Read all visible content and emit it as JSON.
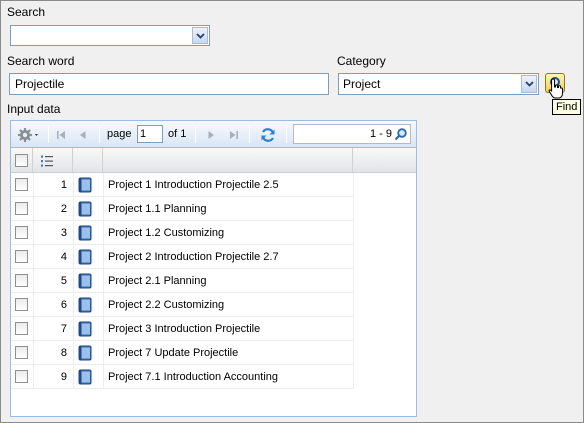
{
  "search": {
    "label": "Search",
    "value": ""
  },
  "search_word": {
    "label": "Search word",
    "value": "Projectile"
  },
  "category": {
    "label": "Category",
    "value": "Project"
  },
  "find": {
    "tooltip": "Find"
  },
  "input_data": {
    "label": "Input data"
  },
  "pager": {
    "page_label": "page",
    "page_value": "1",
    "of_label": "of 1",
    "range": "1 - 9"
  },
  "rows": [
    {
      "num": "1",
      "title": "Project 1 Introduction Projectile 2.5"
    },
    {
      "num": "2",
      "title": "Project 1.1 Planning"
    },
    {
      "num": "3",
      "title": "Project 1.2 Customizing"
    },
    {
      "num": "4",
      "title": "Project 2 Introduction Projectile 2.7"
    },
    {
      "num": "5",
      "title": "Project 2.1 Planning"
    },
    {
      "num": "6",
      "title": "Project 2.2 Customizing"
    },
    {
      "num": "7",
      "title": "Project 3 Introduction Projectile"
    },
    {
      "num": "8",
      "title": "Project 7 Update Projectile"
    },
    {
      "num": "9",
      "title": "Project 7.1 Introduction Accounting"
    }
  ],
  "colors": {
    "grid_border": "#99bbe8",
    "book_icon": "#3a6fb5",
    "find_button": "#f2d04a"
  },
  "icons": [
    "gear-icon",
    "first-page-icon",
    "prev-page-icon",
    "next-page-icon",
    "last-page-icon",
    "refresh-icon",
    "magnifier-icon",
    "numbered-list-icon",
    "book-icon",
    "chevron-down-icon"
  ]
}
